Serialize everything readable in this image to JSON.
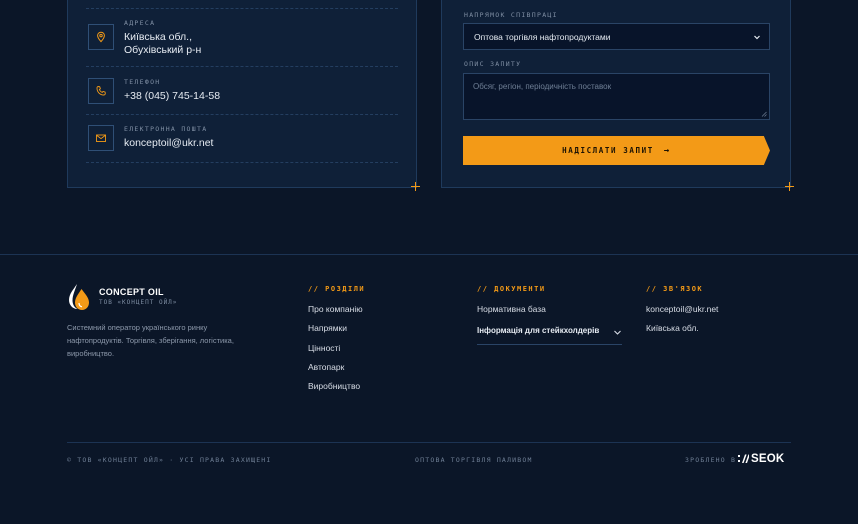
{
  "contacts": {
    "address": {
      "label": "АДРЕСА",
      "line1": "Київська обл.,",
      "line2": "Обухівський р-н",
      "icon": "map-pin-icon"
    },
    "phone": {
      "label": "ТЕЛЕФОН",
      "value": "+38 (045) 745-14-58",
      "icon": "phone-icon"
    },
    "email": {
      "label": "ЕЛЕКТРОННА ПОШТА",
      "value": "konceptoil@ukr.net",
      "icon": "mail-icon"
    }
  },
  "form": {
    "direction_label": "НАПРЯМОК СПІВПРАЦІ",
    "direction_value": "Оптова торгівля нафтопродуктами",
    "description_label": "ОПИС ЗАПИТУ",
    "description_placeholder": "Обсяг, регіон, періодичність поставок",
    "submit_label": "НАДІСЛАТИ ЗАПИТ",
    "submit_arrow": "→"
  },
  "footer": {
    "brand": {
      "name": "CONCEPT OIL",
      "subtitle": "ТОВ «КОНЦЕПТ ОЙЛ»",
      "description": "Системний оператор українського ринку нафтопродуктів. Торгівля, зберігання, логістика, виробництво."
    },
    "sections": {
      "heading": "// РОЗДІЛИ",
      "links": [
        "Про компанію",
        "Напрямки",
        "Цінності",
        "Автопарк",
        "Виробництво"
      ]
    },
    "documents": {
      "heading": "// ДОКУМЕНТИ",
      "link": "Нормативна база",
      "accordion_label": "Інформація для стейкхолдерів"
    },
    "contact": {
      "heading": "// ЗВ'ЯЗОК",
      "email": "konceptoil@ukr.net",
      "region": "Київська обл."
    },
    "bottom": {
      "copyright": "© ТОВ «КОНЦЕПТ ОЙЛ» · УСІ ПРАВА ЗАХИЩЕНІ",
      "tagline": "ОПТОВА ТОРГІВЛЯ ПАЛИВОМ",
      "made_by": "ЗРОБЛЕНО В",
      "agency": "SEOK"
    }
  },
  "colors": {
    "background": "#0b1628",
    "card": "#0f2038",
    "accent": "#f39a17"
  }
}
